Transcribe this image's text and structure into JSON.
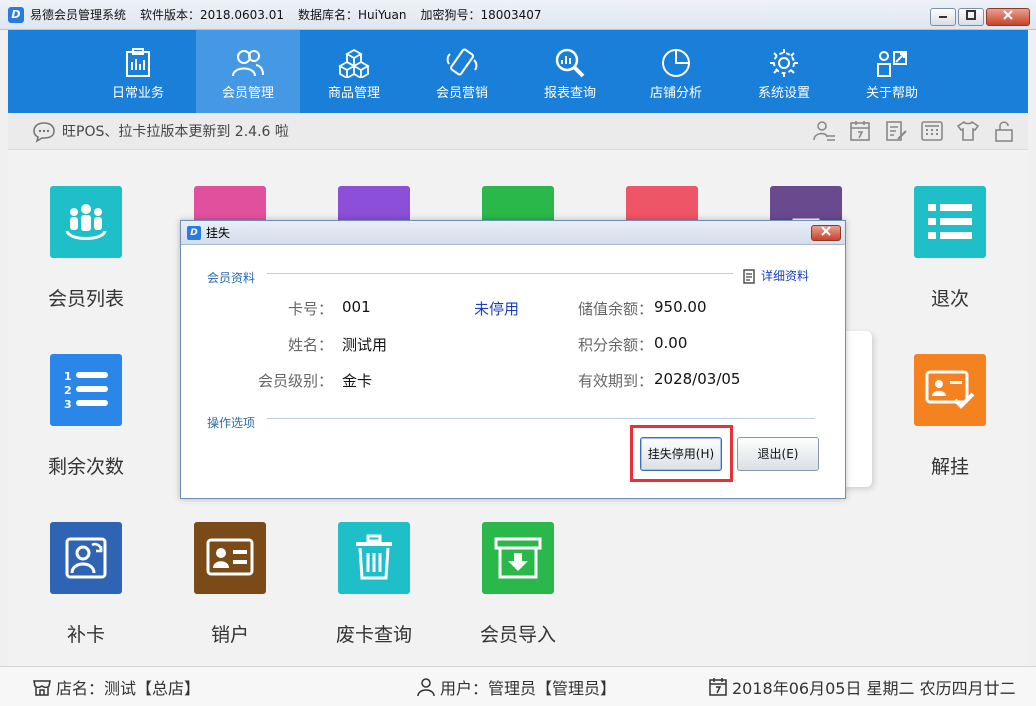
{
  "titlebar": {
    "app_name": "易德会员管理系统",
    "version": "软件版本：2018.0603.01",
    "database": "数据库名：HuiYuan",
    "dongle": "加密狗号：18003407",
    "logo_letter": "D"
  },
  "nav": [
    {
      "label": "日常业务",
      "icon": "clipboard-icon"
    },
    {
      "label": "会员管理",
      "icon": "users-icon",
      "active": true
    },
    {
      "label": "商品管理",
      "icon": "cubes-icon"
    },
    {
      "label": "会员营销",
      "icon": "phone-icon"
    },
    {
      "label": "报表查询",
      "icon": "search-chart-icon"
    },
    {
      "label": "店铺分析",
      "icon": "pie-chart-icon"
    },
    {
      "label": "系统设置",
      "icon": "gear-icon"
    },
    {
      "label": "关于帮助",
      "icon": "help-icon"
    }
  ],
  "notice": {
    "text": "旺POS、拉卡拉版本更新到 2.4.6 啦"
  },
  "tiles": [
    {
      "label": "会员列表",
      "color": "#1fbfc9"
    },
    {
      "label": "",
      "color": "#e0509d"
    },
    {
      "label": "",
      "color": "#8b4fd8"
    },
    {
      "label": "",
      "color": "#2bb84a"
    },
    {
      "label": "",
      "color": "#ee5566"
    },
    {
      "label": "",
      "color": "#6a4a8e"
    },
    {
      "label": "退次",
      "color": "#1fbfc9"
    },
    {
      "label": "剩余次数",
      "color": "#2a86e8"
    },
    {
      "label": "解挂",
      "color": "#f58220"
    },
    {
      "label": "补卡",
      "color": "#2f64b4"
    },
    {
      "label": "销户",
      "color": "#7a4a18"
    },
    {
      "label": "废卡查询",
      "color": "#1fbfc9"
    },
    {
      "label": "会员导入",
      "color": "#2bb84a"
    }
  ],
  "status": {
    "store": "店名：测试【总店】",
    "user": "用户：管理员【管理员】",
    "date": "2018年06月05日 星期二 农历四月廿二"
  },
  "dialog": {
    "title": "挂失",
    "section_member": "会员资料",
    "detail_link": "详细资料",
    "card_label": "卡号：",
    "card_value": "001",
    "card_status": "未停用",
    "name_label": "姓名：",
    "name_value": "测试用",
    "level_label": "会员级别：",
    "level_value": "金卡",
    "balance_label": "储值余额：",
    "balance_value": "950.00",
    "points_label": "积分余额：",
    "points_value": "0.00",
    "expiry_label": "有效期到：",
    "expiry_value": "2028/03/05",
    "section_options": "操作选项",
    "btn_report_loss": "挂失停用(H)",
    "btn_exit": "退出(E)"
  },
  "colors": {
    "nav_bg": "#1a7fd8",
    "nav_active": "#4498e4",
    "highlight": "#e8323a"
  }
}
